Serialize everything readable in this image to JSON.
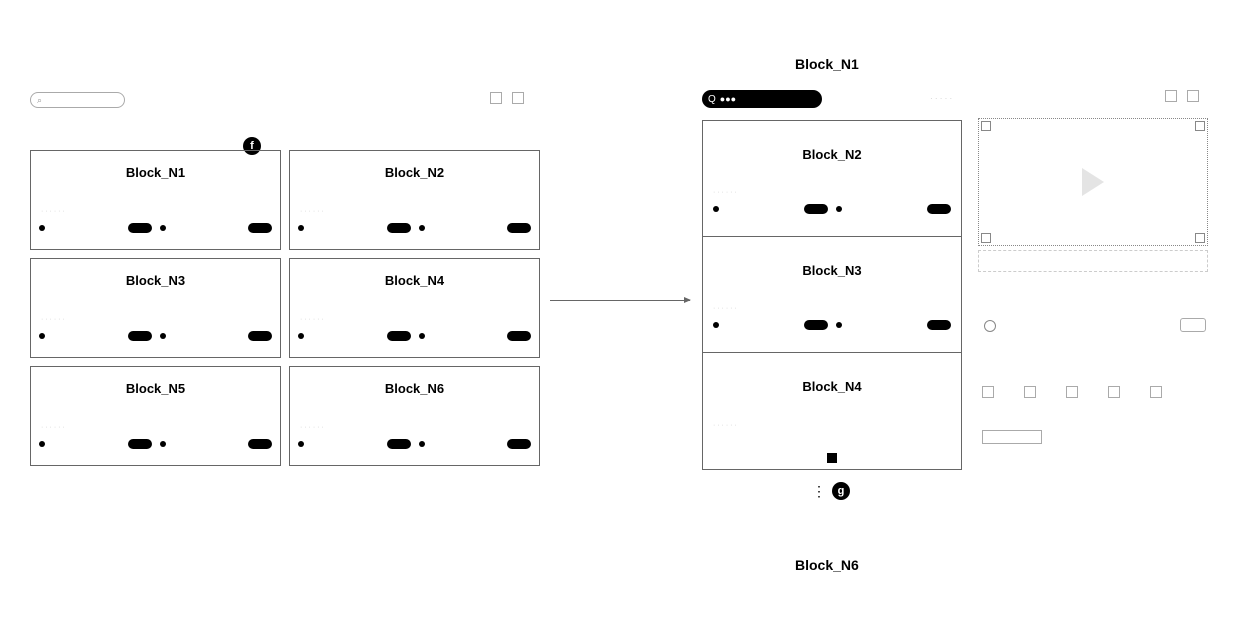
{
  "labels": {
    "top_n1": "Block_N1",
    "bottom_n6": "Block_N6",
    "badge_f": "f",
    "badge_g": "g"
  },
  "left_panel": {
    "search_placeholder": "",
    "blocks": [
      {
        "title": "Block_N1"
      },
      {
        "title": "Block_N2"
      },
      {
        "title": "Block_N3"
      },
      {
        "title": "Block_N4"
      },
      {
        "title": "Block_N5"
      },
      {
        "title": "Block_N6"
      }
    ]
  },
  "right_panel": {
    "search_label": "Q",
    "search_text": "●●●",
    "list": [
      {
        "title": "Block_N2"
      },
      {
        "title": "Block_N3"
      },
      {
        "title": "Block_N4"
      }
    ]
  }
}
